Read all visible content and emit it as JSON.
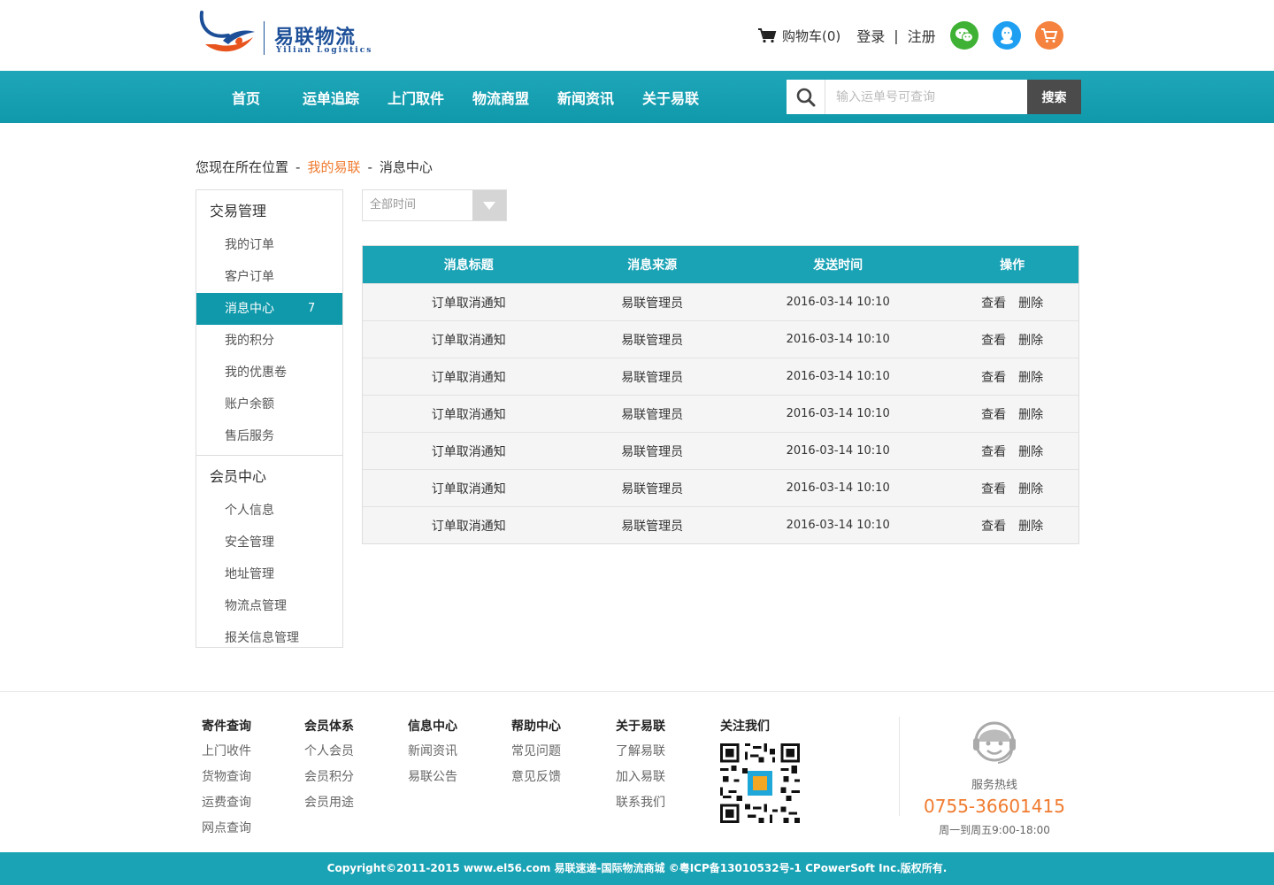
{
  "brand": {
    "name_cn": "易联物流",
    "name_en": "Yilian Logistics"
  },
  "header": {
    "cart_label": "购物车(0)",
    "login": "登录",
    "separator": "|",
    "register": "注册",
    "social_icons": [
      "wechat-icon",
      "qq-icon",
      "shop-cart-icon"
    ],
    "social_colors": [
      "#3fb235",
      "#1e9ff2",
      "#f5823e"
    ]
  },
  "nav": {
    "items": [
      "首页",
      "运单追踪",
      "上门取件",
      "物流商盟",
      "新闻资讯",
      "关于易联"
    ],
    "search_placeholder": "输入运单号可查询",
    "search_button": "搜索"
  },
  "breadcrumb": {
    "prefix": "您现在所在位置",
    "sep": "-",
    "level1": "我的易联",
    "level2": "消息中心"
  },
  "sidebar": {
    "group1_title": "交易管理",
    "group1_items": [
      "我的订单",
      "客户订单",
      "消息中心",
      "我的积分",
      "我的优惠卷",
      "账户余额",
      "售后服务"
    ],
    "active_badge": "7",
    "group2_title": "会员中心",
    "group2_items": [
      "个人信息",
      "安全管理",
      "地址管理",
      "物流点管理",
      "报关信息管理"
    ]
  },
  "filter": {
    "value": "全部时间"
  },
  "table": {
    "headers": [
      "消息标题",
      "消息来源",
      "发送时间",
      "操作"
    ],
    "rows": [
      {
        "title": "订单取消通知",
        "source": "易联管理员",
        "time": "2016-03-14 10:10"
      },
      {
        "title": "订单取消通知",
        "source": "易联管理员",
        "time": "2016-03-14 10:10"
      },
      {
        "title": "订单取消通知",
        "source": "易联管理员",
        "time": "2016-03-14 10:10"
      },
      {
        "title": "订单取消通知",
        "source": "易联管理员",
        "time": "2016-03-14 10:10"
      },
      {
        "title": "订单取消通知",
        "source": "易联管理员",
        "time": "2016-03-14 10:10"
      },
      {
        "title": "订单取消通知",
        "source": "易联管理员",
        "time": "2016-03-14 10:10"
      },
      {
        "title": "订单取消通知",
        "source": "易联管理员",
        "time": "2016-03-14 10:10"
      }
    ],
    "op_view": "查看",
    "op_delete": "删除"
  },
  "footer": {
    "columns": [
      {
        "title": "寄件查询",
        "links": [
          "上门收件",
          "货物查询",
          "运费查询",
          "网点查询"
        ]
      },
      {
        "title": "会员体系",
        "links": [
          "个人会员",
          "会员积分",
          "会员用途"
        ]
      },
      {
        "title": "信息中心",
        "links": [
          "新闻资讯",
          "易联公告"
        ]
      },
      {
        "title": "帮助中心",
        "links": [
          "常见问题",
          "意见反馈"
        ]
      },
      {
        "title": "关于易联",
        "links": [
          "了解易联",
          "加入易联",
          "联系我们"
        ]
      }
    ],
    "follow_title": "关注我们",
    "hotline_label": "服务热线",
    "hotline_number": "0755-36601415",
    "hotline_hours": "周一到周五9:00-18:00",
    "copyright": "Copyright©2011-2015 www.el56.com 易联速递-国际物流商城 ©粤ICP备13010532号-1 CPowerSoft Inc.版权所有."
  },
  "colors": {
    "primary": "#1aa2b5",
    "accent": "#f07b2f",
    "brand_blue": "#1c4f98"
  }
}
